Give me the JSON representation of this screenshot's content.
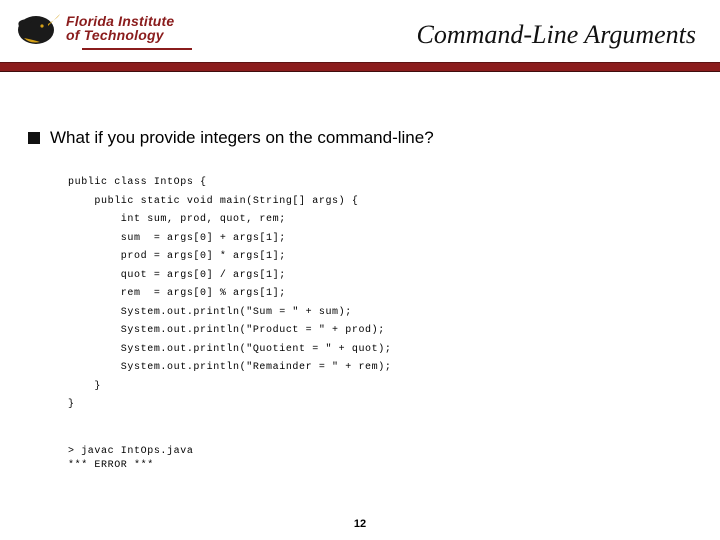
{
  "header": {
    "logo_line1": "Florida Institute",
    "logo_line2": "of Technology",
    "title": "Command-Line Arguments"
  },
  "bullet": {
    "text": "What if you provide integers on the command-line?"
  },
  "code": {
    "l0": "public class IntOps {",
    "l1": "    public static void main(String[] args) {",
    "l2": "        int sum, prod, quot, rem;",
    "l3": "        sum  = args[0] + args[1];",
    "l4": "        prod = args[0] * args[1];",
    "l5": "        quot = args[0] / args[1];",
    "l6": "        rem  = args[0] % args[1];",
    "l7": "        System.out.println(\"Sum = \" + sum);",
    "l8": "        System.out.println(\"Product = \" + prod);",
    "l9": "        System.out.println(\"Quotient = \" + quot);",
    "l10": "        System.out.println(\"Remainder = \" + rem);",
    "l11": "    }",
    "l12": "}"
  },
  "shell": {
    "l0": "> javac IntOps.java",
    "l1": "*** ERROR ***"
  },
  "page_number": "12"
}
